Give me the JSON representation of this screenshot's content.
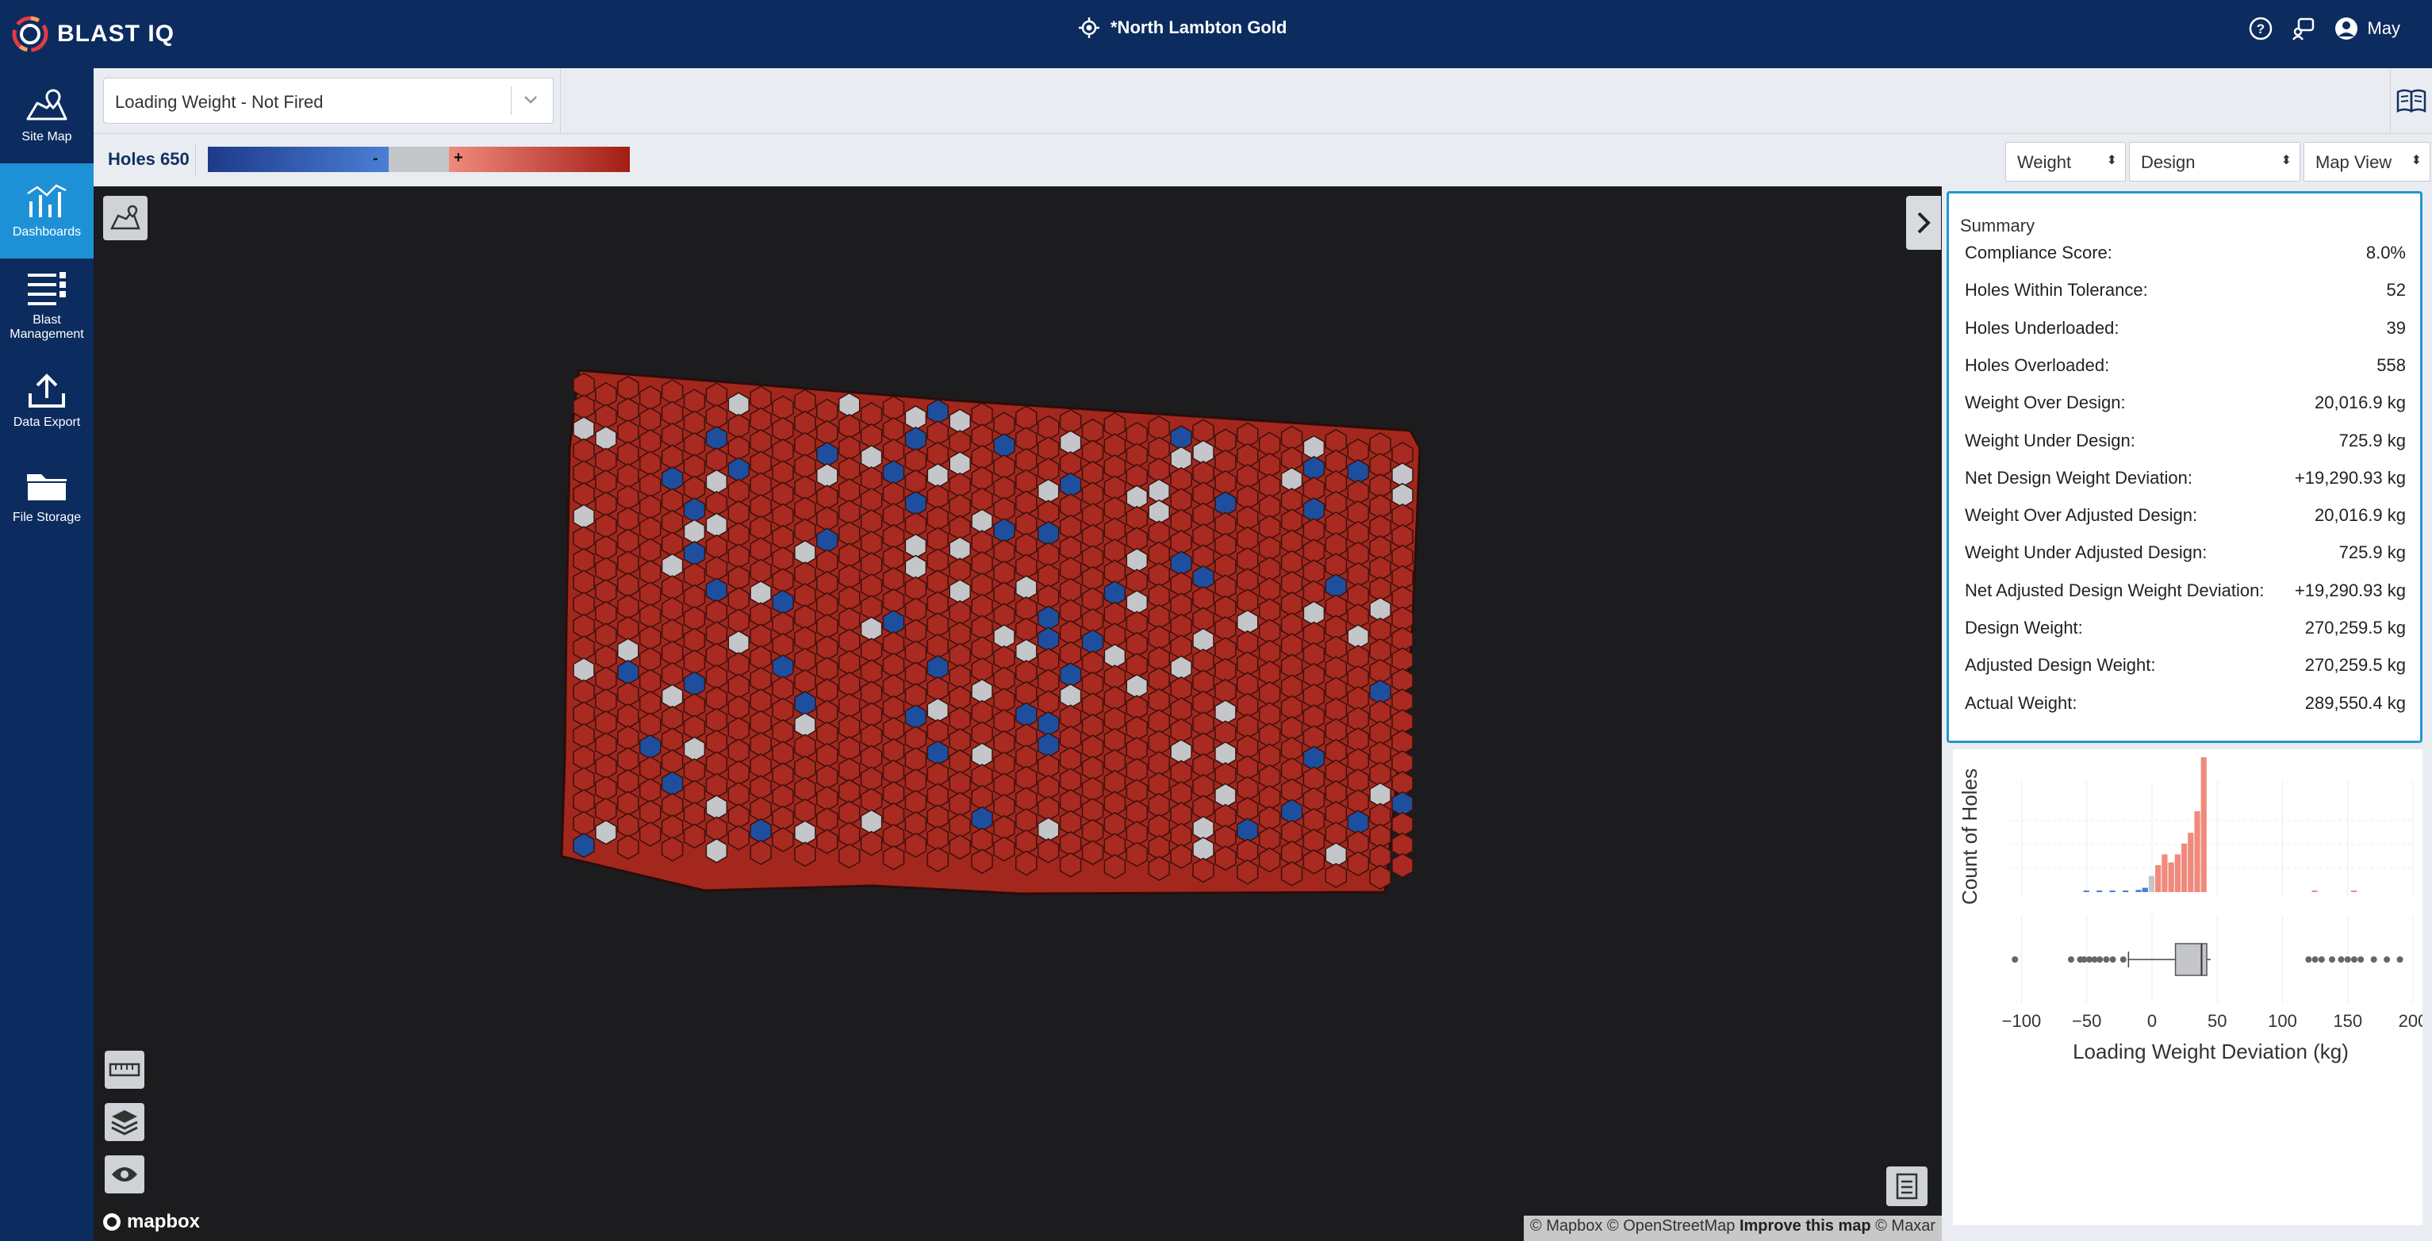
{
  "app": {
    "brand": "BLAST IQ",
    "site_title": "*North Lambton Gold",
    "user": "May"
  },
  "sidebar": {
    "items": [
      {
        "label": "Site Map"
      },
      {
        "label": "Dashboards",
        "active": true
      },
      {
        "label": "Blast Management"
      },
      {
        "label": "Data Export"
      },
      {
        "label": "File Storage"
      }
    ]
  },
  "toolbar": {
    "layer_select": "Loading Weight - Not Fired"
  },
  "legend": {
    "holes_label": "Holes 650",
    "minus": "-",
    "plus": "+",
    "colors": {
      "under": "#1e4f9e",
      "within": "#c4c6c9",
      "over": "#a92a20"
    }
  },
  "controls": {
    "metric": "Weight",
    "reference": "Design",
    "view": "Map View"
  },
  "map": {
    "attribution": "© Mapbox © OpenStreetMap",
    "improve": "Improve this map",
    "maxar": "© Maxar",
    "logo": "mapbox"
  },
  "summary": {
    "title": "Summary",
    "rows": [
      {
        "label": "Compliance Score:",
        "value": "8.0%"
      },
      {
        "label": "Holes Within Tolerance:",
        "value": "52"
      },
      {
        "label": "Holes Underloaded:",
        "value": "39"
      },
      {
        "label": "Holes Overloaded:",
        "value": "558"
      },
      {
        "label": "Weight Over Design:",
        "value": "20,016.9 kg"
      },
      {
        "label": "Weight Under Design:",
        "value": "725.9 kg"
      },
      {
        "label": "Net Design Weight Deviation:",
        "value": "+19,290.93 kg"
      },
      {
        "label": "Weight Over Adjusted Design:",
        "value": "20,016.9 kg"
      },
      {
        "label": "Weight Under Adjusted Design:",
        "value": "725.9 kg"
      },
      {
        "label": "Net Adjusted Design Weight Deviation:",
        "value": "+19,290.93 kg"
      },
      {
        "label": "Design Weight:",
        "value": "270,259.5 kg"
      },
      {
        "label": "Adjusted Design Weight:",
        "value": "270,259.5 kg"
      },
      {
        "label": "Actual Weight:",
        "value": "289,550.4 kg"
      }
    ]
  },
  "chart_data": {
    "type": "bar",
    "xlabel": "Loading Weight Deviation (kg)",
    "ylabel": "Count of Holes",
    "xlim": [
      -110,
      200
    ],
    "xticks": [
      "−100",
      "−50",
      "0",
      "50",
      "100",
      "150",
      "200"
    ],
    "tick_values": [
      -100,
      -50,
      0,
      50,
      100,
      150,
      200
    ],
    "histogram": [
      {
        "x": -50,
        "count": 1,
        "color": "#4a7fd6"
      },
      {
        "x": -40,
        "count": 1,
        "color": "#4a7fd6"
      },
      {
        "x": -30,
        "count": 1,
        "color": "#4a7fd6"
      },
      {
        "x": -20,
        "count": 2,
        "color": "#4a7fd6"
      },
      {
        "x": -10,
        "count": 4,
        "color": "#4a7fd6"
      },
      {
        "x": -5,
        "count": 8,
        "color": "#4a7fd6"
      },
      {
        "x": 0,
        "count": 30,
        "color": "#c4c6c9"
      },
      {
        "x": 5,
        "count": 50,
        "color": "#f08a7d"
      },
      {
        "x": 10,
        "count": 70,
        "color": "#f08a7d"
      },
      {
        "x": 15,
        "count": 55,
        "color": "#f08a7d"
      },
      {
        "x": 20,
        "count": 70,
        "color": "#f08a7d"
      },
      {
        "x": 25,
        "count": 90,
        "color": "#f08a7d"
      },
      {
        "x": 30,
        "count": 110,
        "color": "#f08a7d"
      },
      {
        "x": 35,
        "count": 150,
        "color": "#f08a7d"
      },
      {
        "x": 40,
        "count": 250,
        "color": "#f08a7d"
      },
      {
        "x": 125,
        "count": 2,
        "color": "#f08a7d"
      },
      {
        "x": 155,
        "count": 2,
        "color": "#f08a7d"
      }
    ],
    "boxplot": {
      "q1": 18,
      "median": 38,
      "q3": 42,
      "whisker_low": -18,
      "whisker_high": 45,
      "outliers": [
        -105,
        -62,
        -55,
        -52,
        -48,
        -44,
        -40,
        -35,
        -30,
        -22,
        120,
        125,
        130,
        138,
        145,
        150,
        155,
        160,
        170,
        180,
        190
      ]
    }
  }
}
